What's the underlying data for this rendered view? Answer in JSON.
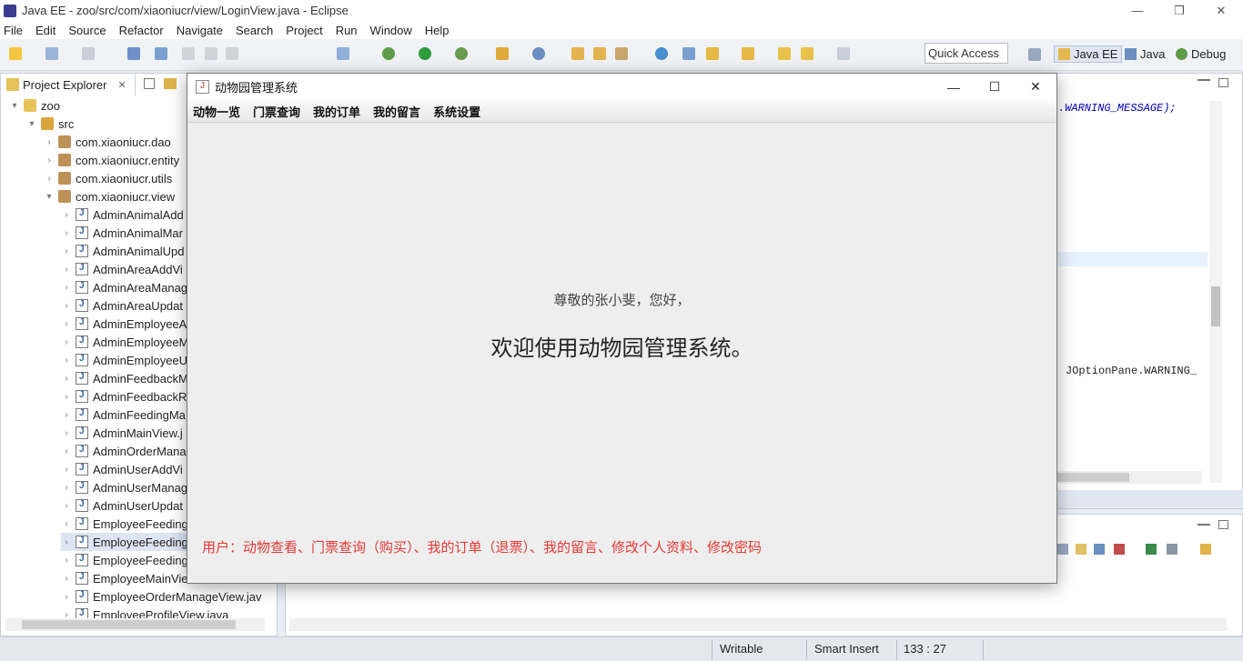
{
  "window": {
    "title": "Java EE - zoo/src/com/xiaoniucr/view/LoginView.java - Eclipse",
    "controls": [
      "—",
      "❐",
      "✕"
    ]
  },
  "menu": [
    "File",
    "Edit",
    "Source",
    "Refactor",
    "Navigate",
    "Search",
    "Project",
    "Run",
    "Window",
    "Help"
  ],
  "toolbar": {
    "quick_access": "Quick Access",
    "perspectives": [
      "Java EE",
      "Java",
      "Debug"
    ]
  },
  "project_explorer": {
    "tab_label": "Project Explorer",
    "tree": [
      {
        "label": "zoo",
        "icon": "project-icon",
        "expanded": true,
        "level": 0
      },
      {
        "label": "src",
        "icon": "source-folder-icon",
        "expanded": true,
        "level": 1
      },
      {
        "label": "com.xiaoniucr.dao",
        "icon": "package-icon",
        "expanded": false,
        "level": 2
      },
      {
        "label": "com.xiaoniucr.entity",
        "icon": "package-icon",
        "expanded": false,
        "level": 2
      },
      {
        "label": "com.xiaoniucr.utils",
        "icon": "package-icon",
        "expanded": false,
        "level": 2
      },
      {
        "label": "com.xiaoniucr.view",
        "icon": "package-icon",
        "expanded": true,
        "level": 2
      },
      {
        "label": "AdminAnimalAdd",
        "icon": "java-file-icon",
        "level": 3
      },
      {
        "label": "AdminAnimalMar",
        "icon": "java-file-icon",
        "level": 3
      },
      {
        "label": "AdminAnimalUpd",
        "icon": "java-file-icon",
        "level": 3
      },
      {
        "label": "AdminAreaAddVi",
        "icon": "java-file-icon",
        "level": 3
      },
      {
        "label": "AdminAreaManag",
        "icon": "java-file-icon",
        "level": 3
      },
      {
        "label": "AdminAreaUpdat",
        "icon": "java-file-icon",
        "level": 3
      },
      {
        "label": "AdminEmployeeA",
        "icon": "java-file-icon",
        "level": 3
      },
      {
        "label": "AdminEmployeeM",
        "icon": "java-file-icon",
        "level": 3
      },
      {
        "label": "AdminEmployeeU",
        "icon": "java-file-icon",
        "level": 3
      },
      {
        "label": "AdminFeedbackM",
        "icon": "java-file-icon",
        "level": 3
      },
      {
        "label": "AdminFeedbackR",
        "icon": "java-file-icon",
        "level": 3
      },
      {
        "label": "AdminFeedingMa",
        "icon": "java-file-icon",
        "level": 3
      },
      {
        "label": "AdminMainView.j",
        "icon": "java-file-icon",
        "level": 3
      },
      {
        "label": "AdminOrderMana",
        "icon": "java-file-icon",
        "level": 3
      },
      {
        "label": "AdminUserAddVi",
        "icon": "java-file-icon",
        "level": 3
      },
      {
        "label": "AdminUserManag",
        "icon": "java-file-icon",
        "level": 3
      },
      {
        "label": "AdminUserUpdat",
        "icon": "java-file-icon",
        "level": 3
      },
      {
        "label": "EmployeeFeeding",
        "icon": "java-file-icon",
        "level": 3
      },
      {
        "label": "EmployeeFeeding",
        "icon": "java-file-icon",
        "level": 3,
        "selected": true
      },
      {
        "label": "EmployeeFeeding",
        "icon": "java-file-icon",
        "level": 3
      },
      {
        "label": "EmployeeMainVie",
        "icon": "java-file-icon",
        "level": 3
      },
      {
        "label": "EmployeeOrderManageView.jav",
        "icon": "java-file-icon",
        "level": 3
      },
      {
        "label": "EmployeeProfileView.java",
        "icon": "java-file-icon",
        "level": 3
      }
    ]
  },
  "editor": {
    "code_line_1": ".WARNING_MESSAGE);",
    "code_line_2": "JOptionPane.WARNING_"
  },
  "status_bar": {
    "mode": "Writable",
    "insert": "Smart Insert",
    "position": "133 : 27"
  },
  "dialog": {
    "title": "动物园管理系统",
    "menu": [
      "动物一览",
      "门票查询",
      "我的订单",
      "我的留言",
      "系统设置"
    ],
    "greeting": "尊敬的张小斐，您好，",
    "welcome": "欢迎使用动物园管理系统。",
    "roles": "用户：动物查看、门票查询（购买）、我的订单（退票）、我的留言、修改个人资料、修改密码",
    "controls": [
      "—",
      "☐",
      "✕"
    ]
  },
  "colors": {
    "roles_text": "#e53935",
    "selection": "#dde5f3"
  }
}
